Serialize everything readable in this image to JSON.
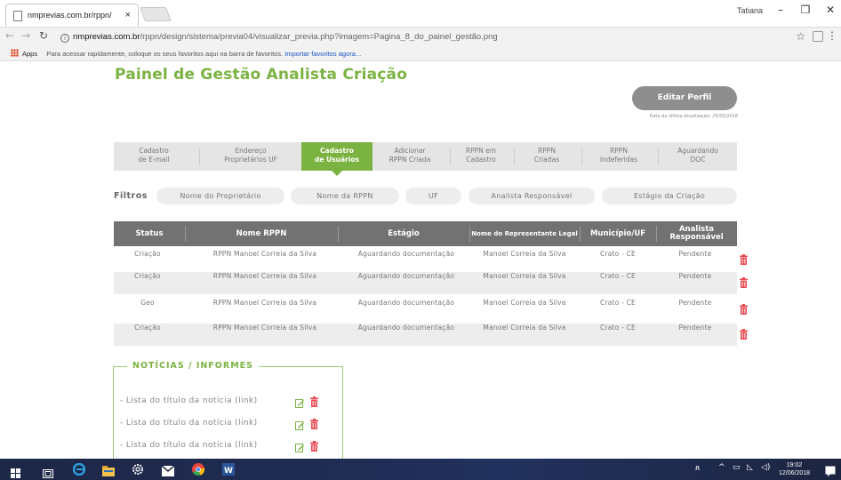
{
  "browser": {
    "tab_title": "nmprevias.com.br/rppn/",
    "tab_close": "×",
    "user_name": "Tatiana",
    "url_host": "nmprevias.com.br",
    "url_path": "/rppn/design/sistema/previa04/visualizar_previa.php?imagem=Pagina_8_do_painel_gestão.png",
    "bookmarks_apps": "Apps",
    "bookmarks_hint": "Para acessar rapidamente, coloque os seus favoritos aqui na barra de favoritos.",
    "bookmarks_link": "Importar favoritos agora..."
  },
  "page": {
    "title": "Painel de Gestão Analista Criação",
    "edit_profile": "Editar Perfil",
    "update_date": "Data da última atualização: 25/05/2018"
  },
  "nav_tabs": [
    {
      "line1": "Cadastro",
      "line2": "de E-mail"
    },
    {
      "line1": "Endereço",
      "line2": "Proprietários UF"
    },
    {
      "line1": "Cadastro",
      "line2": "de Usuários"
    },
    {
      "line1": "Adicionar",
      "line2": "RPPN Criada"
    },
    {
      "line1": "RPPN em",
      "line2": "Cadastro"
    },
    {
      "line1": "RPPN",
      "line2": "Criadas"
    },
    {
      "line1": "RPPN",
      "line2": "Indeferidas"
    },
    {
      "line1": "Aguardando",
      "line2": "DOC"
    }
  ],
  "filters": {
    "label": "Filtros",
    "items": [
      "Nome do Proprietário",
      "Nome da RPPN",
      "UF",
      "Analista Responsável",
      "Estágio da Criação"
    ]
  },
  "table": {
    "headers": [
      "Status",
      "Nome RPPN",
      "Estágio",
      "Nome do Representante Legal",
      "Município/UF",
      "Analista Responsável"
    ],
    "rows": [
      [
        "Criação",
        "RPPN Manoel Correia da Silva",
        "Aguardando documentação",
        "Manoel Correia da Silva",
        "Crato - CE",
        "Pendente"
      ],
      [
        "Criação",
        "RPPN Manoel Correia da Silva",
        "Aguardando documentação",
        "Manoel Correia da Silva",
        "Crato - CE",
        "Pendente"
      ],
      [
        "Geo",
        "RPPN Manoel Correia da Silva",
        "Aguardando documentação",
        "Manoel Correia da Silva",
        "Crato - CE",
        "Pendente"
      ],
      [
        "Criação",
        "RPPN Manoel Correia da Silva",
        "Aguardando documentação",
        "Manoel Correia da Silva",
        "Crato - CE",
        "Pendente"
      ]
    ]
  },
  "news": {
    "title": "NOTÍCIAS / INFORMES",
    "items": [
      "- Lista do título da notícia (link)",
      "- Lista do título da notícia (link)",
      "- Lista do título da notícia (link)"
    ]
  },
  "taskbar": {
    "time": "19:02",
    "date": "12/06/2018"
  },
  "colors": {
    "accent": "#7bb342",
    "delete": "#e8474f",
    "header": "#727272"
  }
}
